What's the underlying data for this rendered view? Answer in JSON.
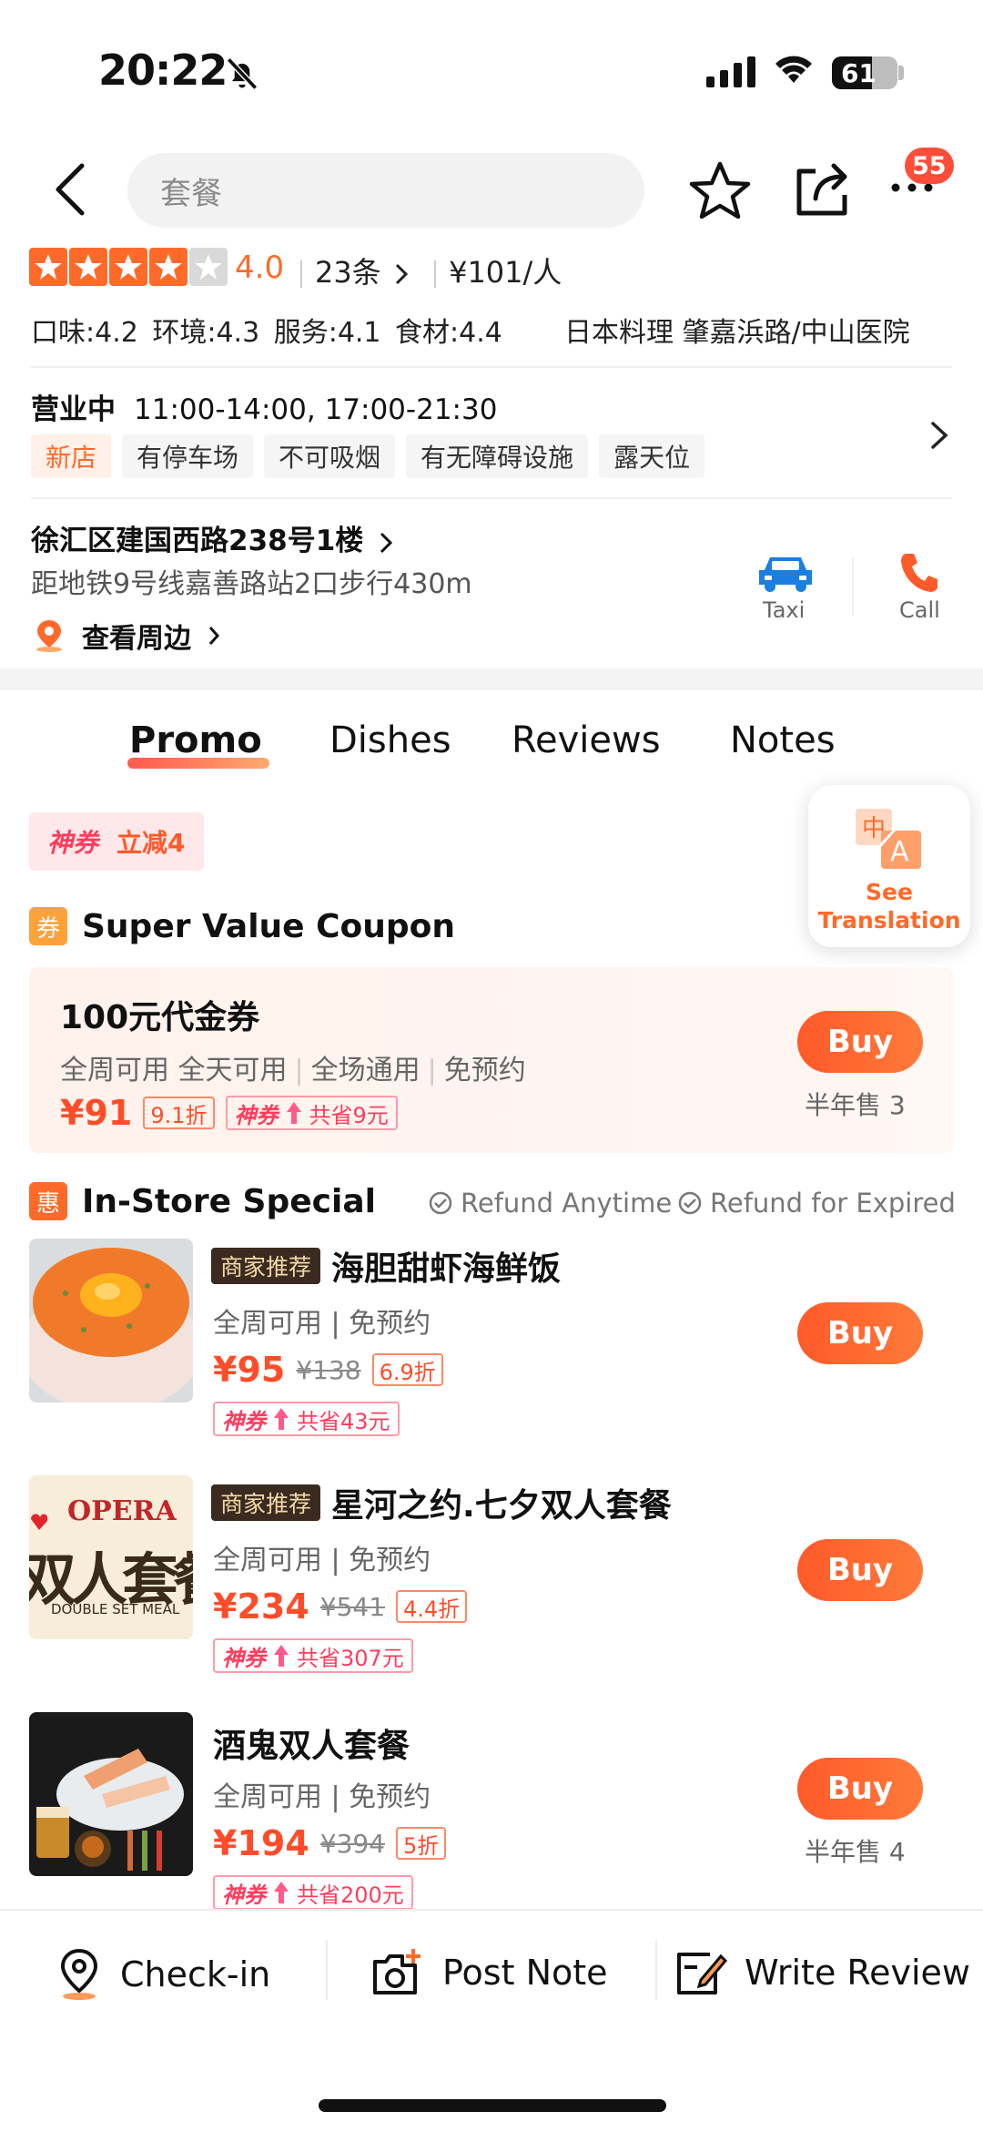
{
  "status_bar": {
    "time": "20:22",
    "battery": "61",
    "battery_level": 0.61
  },
  "header": {
    "search_placeholder": "套餐",
    "notification_count": "55"
  },
  "rating": {
    "score": "4.0",
    "stars_filled": 4,
    "reviews": "23条",
    "price": "¥101/人"
  },
  "scores": "口味:4.2 环境:4.3 服务:4.1 食材:4.4",
  "category": "日本料理  肇嘉浜路/中山医院",
  "hours": {
    "status": "营业中",
    "times": "11:00-14:00, 17:00-21:30"
  },
  "tags": [
    "新店",
    "有停车场",
    "不可吸烟",
    "有无障碍设施",
    "露天位"
  ],
  "address": {
    "line1": "徐汇区建国西路238号1楼",
    "line2": "距地铁9号线嘉善路站2口步行430m",
    "nearby": "查看周边"
  },
  "actions": {
    "taxi": "Taxi",
    "call": "Call"
  },
  "tabs": [
    "Promo",
    "Dishes",
    "Reviews",
    "Notes"
  ],
  "coupon_chip": {
    "brand": "神券",
    "text": "立减4"
  },
  "translate": {
    "line1": "See",
    "line2": "Translation"
  },
  "super_value": {
    "icon": "券",
    "title": "Super Value Coupon",
    "voucher": {
      "title": "100元代金券",
      "sub": [
        "全周可用 全天可用",
        "全场通用",
        "免预约"
      ],
      "price": "¥91",
      "discount": "9.1折",
      "save_brand": "神券",
      "save_text": "共省9元",
      "buy": "Buy",
      "sold": "半年售 3"
    }
  },
  "in_store": {
    "icon": "惠",
    "title": "In-Store Special",
    "refund1": "Refund Anytime",
    "refund2": "Refund for Expired",
    "deals": [
      {
        "rec": "商家推荐",
        "title": "海胆甜虾海鲜饭",
        "sub": "全周可用 | 免预约",
        "price": "¥95",
        "orig": "¥138",
        "discount": "6.9折",
        "save_brand": "神券",
        "save_text": "共省43元",
        "buy": "Buy",
        "sold": ""
      },
      {
        "rec": "商家推荐",
        "title": "星河之约.七夕双人套餐",
        "sub": "全周可用 | 免预约",
        "price": "¥234",
        "orig": "¥541",
        "discount": "4.4折",
        "save_brand": "神券",
        "save_text": "共省307元",
        "buy": "Buy",
        "sold": "",
        "thumb_text1": "OPERA",
        "thumb_text2": "双人套餐",
        "thumb_text3": "DOUBLE SET MEAL"
      },
      {
        "rec": "",
        "title": "酒鬼双人套餐",
        "sub": "全周可用 | 免预约",
        "price": "¥194",
        "orig": "¥394",
        "discount": "5折",
        "save_brand": "神券",
        "save_text": "共省200元",
        "buy": "Buy",
        "sold": "半年售 4"
      }
    ]
  },
  "bottom_bar": {
    "checkin": "Check-in",
    "post_note": "Post Note",
    "write_review": "Write Review"
  }
}
